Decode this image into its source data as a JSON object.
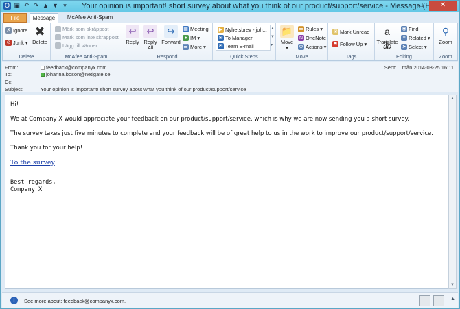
{
  "window": {
    "title": "Your opinion is important! short survey about what you think of our product/support/service - Message (HTML)"
  },
  "tabs": {
    "file": "File",
    "message": "Message",
    "mcafee": "McAfee Anti-Spam"
  },
  "ribbon": {
    "delete": {
      "ignore": "Ignore",
      "junk": "Junk",
      "delete": "Delete",
      "label": "Delete"
    },
    "mcafee": {
      "mark_spam": "Märk som skräppost",
      "mark_not_spam": "Märk som inte skräppost",
      "add_friends": "Lägg till vänner",
      "label": "McAfee Anti-Spam"
    },
    "respond": {
      "reply": "Reply",
      "reply_all_1": "Reply",
      "reply_all_2": "All",
      "forward": "Forward",
      "meeting": "Meeting",
      "im": "IM",
      "more": "More",
      "label": "Respond"
    },
    "quicksteps": {
      "item1": "Nyhetsbrev - joh...",
      "item2": "To Manager",
      "item3": "Team E-mail",
      "label": "Quick Steps"
    },
    "move": {
      "move": "Move",
      "rules": "Rules",
      "onenote": "OneNote",
      "actions": "Actions",
      "label": "Move"
    },
    "tags": {
      "mark_unread": "Mark Unread",
      "follow_up": "Follow Up",
      "label": "Tags"
    },
    "editing": {
      "translate": "Translate",
      "find": "Find",
      "related": "Related",
      "select": "Select",
      "label": "Editing"
    },
    "zoom": {
      "zoom": "Zoom",
      "label": "Zoom"
    }
  },
  "header": {
    "from_label": "From:",
    "from": "feedback@companyx.com",
    "to_label": "To:",
    "to": "johanna.boson@netigate.se",
    "cc_label": "Cc:",
    "subject_label": "Subject:",
    "subject": "Your opinion is important! short survey about what you think of our product/support/service",
    "sent_label": "Sent:",
    "sent": "mån 2014-08-25 16:11"
  },
  "body": {
    "greeting": "Hi!",
    "p1": "We at Company X would appreciate your feedback on our product/support/service, which is why we are now sending you a short survey.",
    "p2": "The survey takes just five minutes to complete and your feedback will be of great help to us in the work to improve our product/support/service.",
    "p3": "Thank you for your help!",
    "link": "To the survey",
    "regards": "Best regards,",
    "company": "Company X"
  },
  "peoplebar": {
    "see_more": "See more about: feedback@companyx.com."
  }
}
